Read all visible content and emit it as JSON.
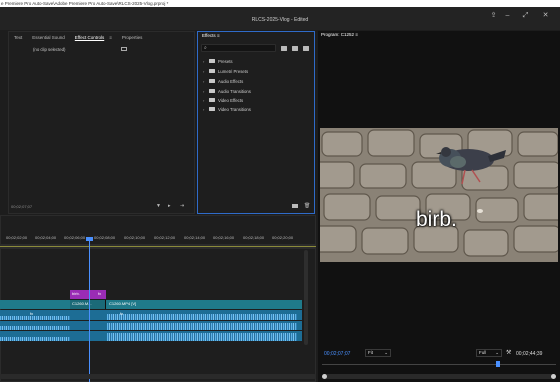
{
  "window": {
    "path_title": "e Premiere Pro Auto-Save\\Adobe Premiere Pro Auto-Save\\RLCS-2025-Vlog.prproj *",
    "doc_title": "RLCS-2025-Vlog - Edited"
  },
  "source_panel": {
    "tabs": [
      "Text",
      "Essential Sound",
      "Effect Controls",
      "Properties"
    ],
    "active_tab": 2,
    "menu_glyph": "≡",
    "no_clip": "(no clip selected)",
    "timecode": "00;02;07;07"
  },
  "effects_panel": {
    "title": "Effects",
    "menu_glyph": "≡",
    "items": [
      "Presets",
      "Lumetri Presets",
      "Audio Effects",
      "Audio Transitions",
      "Video Effects",
      "Video Transitions"
    ]
  },
  "program_panel": {
    "title": "Program: C1252",
    "menu_glyph": "≡",
    "caption": "birb.",
    "timecode": "00;02;07;07",
    "fit_label": "Fit",
    "full_label": "Full",
    "duration": "00;02;44;39"
  },
  "timeline": {
    "ruler": [
      "00;02;02;00",
      "00;02;04;00",
      "00;02;06;00",
      "00;02;08;00",
      "00;02;10;00",
      "00;02;12;00",
      "00;02;14;00",
      "00;02;16;00",
      "00;02;18;00",
      "00;02;20;00"
    ],
    "title_clip": "birb.",
    "title_clip_fx": "fx",
    "clip_a": "C1260.M...",
    "clip_b": "C1260.MP4 [V]",
    "fx": "fx"
  },
  "colors": {
    "accent": "#2f6bc9",
    "clip_teal": "#1f7a8a",
    "clip_purple": "#9a2cb5",
    "audio": "#5eb4e8",
    "playhead": "#4a90ff"
  }
}
